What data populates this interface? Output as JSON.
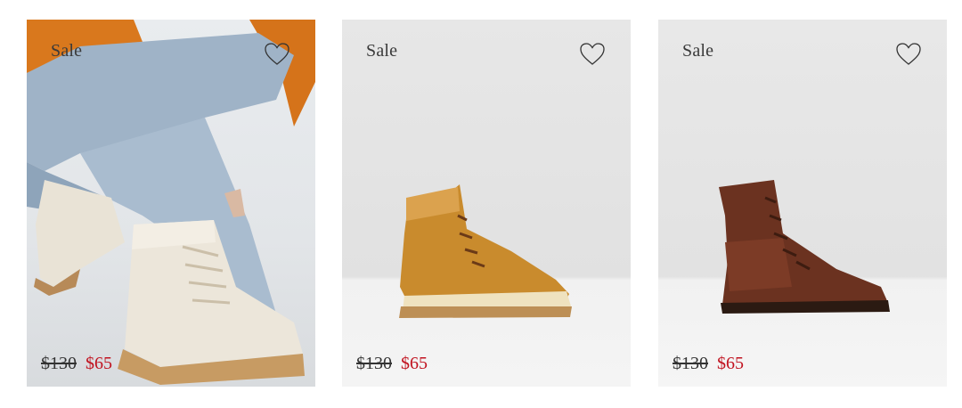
{
  "products": [
    {
      "badge": "Sale",
      "old_price": "$130",
      "new_price": "$65",
      "image": "model-in-cream-lace-up-boots",
      "wishlist_icon": "heart-outline-icon"
    },
    {
      "badge": "Sale",
      "old_price": "$130",
      "new_price": "$65",
      "image": "tan-nubuck-lace-up-boot",
      "wishlist_icon": "heart-outline-icon"
    },
    {
      "badge": "Sale",
      "old_price": "$130",
      "new_price": "$65",
      "image": "brown-leather-lace-up-boot",
      "wishlist_icon": "heart-outline-icon"
    }
  ],
  "colors": {
    "sale_price": "#c1121f",
    "old_price": "#333333"
  }
}
